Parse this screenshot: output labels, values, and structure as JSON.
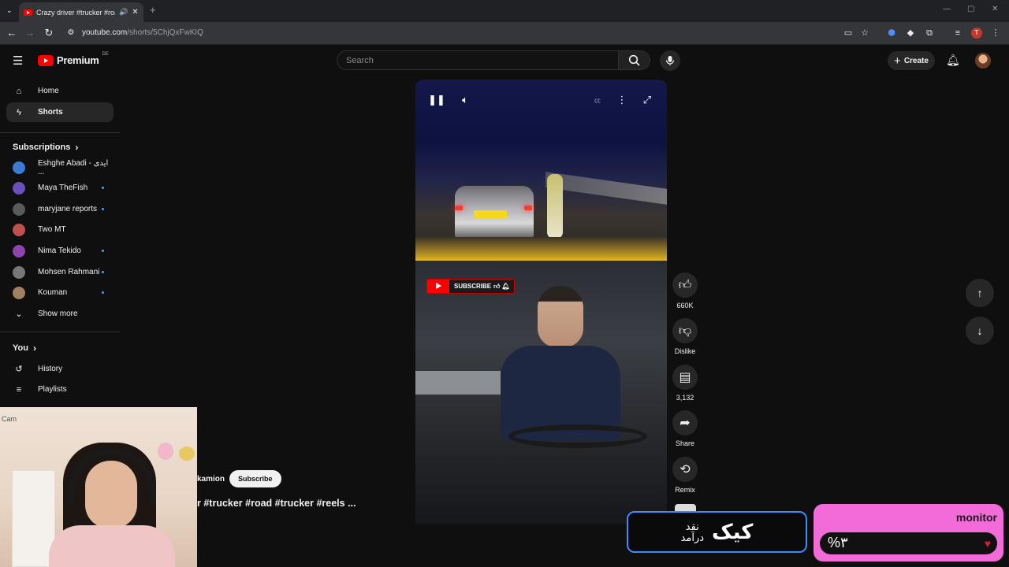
{
  "browser": {
    "tab_title": "Crazy driver #trucker #road",
    "new_tab_symbol": "+",
    "url_host": "youtube.com",
    "url_path": "/shorts/5ChjQxFwKIQ"
  },
  "header": {
    "logo_text": "Premium",
    "logo_region": "DE",
    "search_placeholder": "Search",
    "create_label": "Create",
    "avatar_initial": "T"
  },
  "sidebar": {
    "main": [
      {
        "label": "Home",
        "icon": "home-icon"
      },
      {
        "label": "Shorts",
        "icon": "shorts-icon"
      }
    ],
    "subscriptions_title": "Subscriptions",
    "subscriptions": [
      {
        "label": "Eshghe Abadi - ایدی ...",
        "color": "#3a7bd5",
        "new": false
      },
      {
        "label": "Maya TheFish",
        "color": "#6b4fbb",
        "new": true
      },
      {
        "label": "maryjane reports",
        "color": "#5a5a5a",
        "new": true
      },
      {
        "label": "Two MT",
        "color": "#c0504d",
        "new": false
      },
      {
        "label": "Nima Tekido",
        "color": "#8e44ad",
        "new": true
      },
      {
        "label": "Mohsen Rahmani",
        "color": "#777777",
        "new": true
      },
      {
        "label": "Kouman",
        "color": "#a08060",
        "new": true
      }
    ],
    "show_more": "Show more",
    "you_title": "You",
    "you_items": [
      {
        "label": "History",
        "icon": "history-icon"
      },
      {
        "label": "Playlists",
        "icon": "playlists-icon"
      }
    ]
  },
  "short": {
    "subscribe_badge": "SUBSCRIBE",
    "channel_name": "kamion",
    "subscribe_label": "Subscribe",
    "caption": "r #trucker #road #trucker #reels ..."
  },
  "actions": {
    "likes": "660K",
    "dislike": "Dislike",
    "comments": "3,132",
    "share": "Share",
    "remix": "Remix"
  },
  "overlays": {
    "webcam_label": "Cam",
    "kick_big": "کیک",
    "kick_line1": "نقد",
    "kick_line2": "درآمد",
    "monitor_title": "monitor",
    "monitor_value": "%۳"
  }
}
